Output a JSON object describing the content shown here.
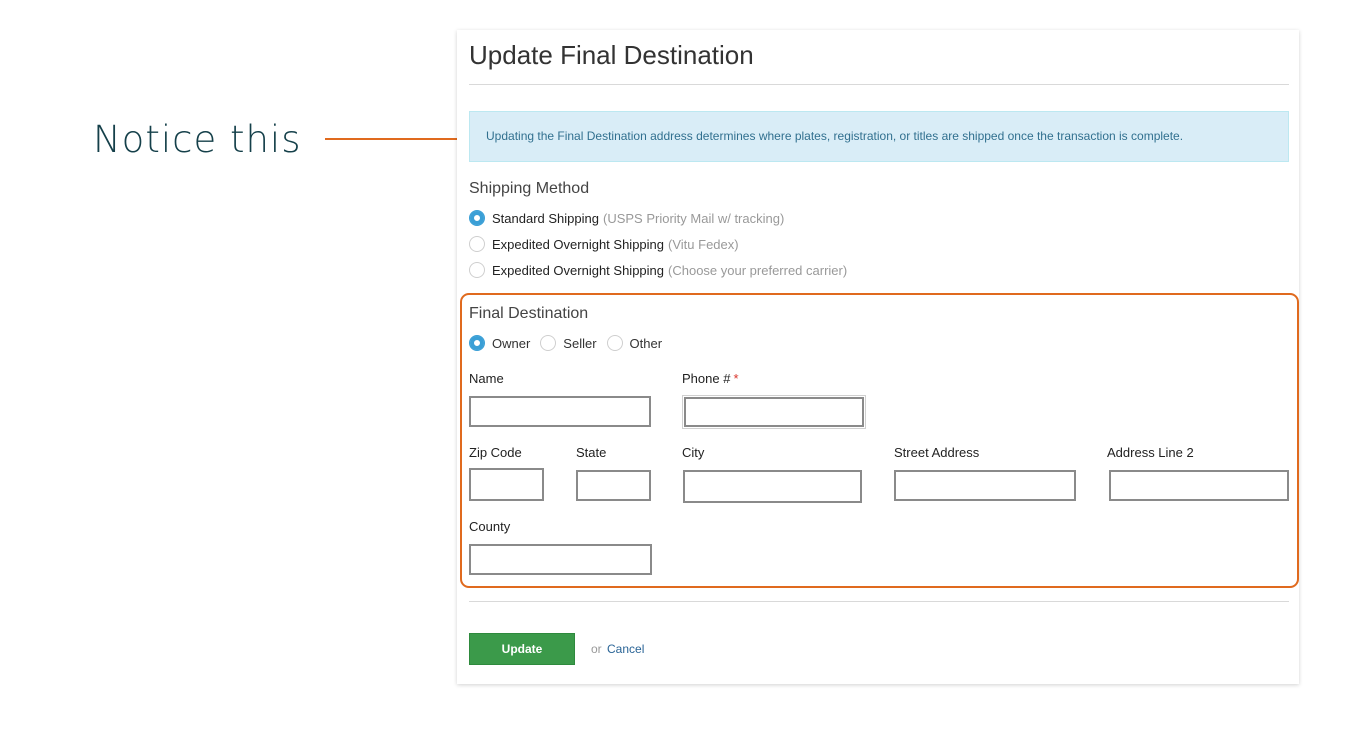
{
  "annotation": {
    "label": "Notice this",
    "accent_color": "#e06a1e"
  },
  "card": {
    "title": "Update Final Destination",
    "info_message": "Updating the Final Destination address determines where plates, registration, or titles are shipped once the transaction is complete."
  },
  "shipping": {
    "label": "Shipping Method",
    "options": [
      {
        "label": "Standard Shipping",
        "detail": "(USPS Priority Mail w/ tracking)",
        "selected": true
      },
      {
        "label": "Expedited Overnight Shipping",
        "detail": "(Vitu Fedex)",
        "selected": false
      },
      {
        "label": "Expedited Overnight Shipping",
        "detail": "(Choose your preferred carrier)",
        "selected": false
      }
    ]
  },
  "final_destination": {
    "label": "Final Destination",
    "options": [
      {
        "label": "Owner",
        "selected": true
      },
      {
        "label": "Seller",
        "selected": false
      },
      {
        "label": "Other",
        "selected": false
      }
    ],
    "fields": {
      "name": {
        "label": "Name",
        "value": ""
      },
      "phone": {
        "label": "Phone #",
        "required_mark": "*",
        "value": ""
      },
      "zip": {
        "label": "Zip Code",
        "value": ""
      },
      "state": {
        "label": "State",
        "value": ""
      },
      "city": {
        "label": "City",
        "value": ""
      },
      "street": {
        "label": "Street Address",
        "value": ""
      },
      "address2": {
        "label": "Address Line 2",
        "value": ""
      },
      "county": {
        "label": "County",
        "value": ""
      }
    }
  },
  "actions": {
    "update_label": "Update",
    "or_text": "or",
    "cancel_label": "Cancel",
    "primary_color": "#3b9a4a"
  },
  "colors": {
    "info_bg": "#d9edf7",
    "info_text": "#31708f",
    "radio_checked": "#3a9fd6"
  }
}
